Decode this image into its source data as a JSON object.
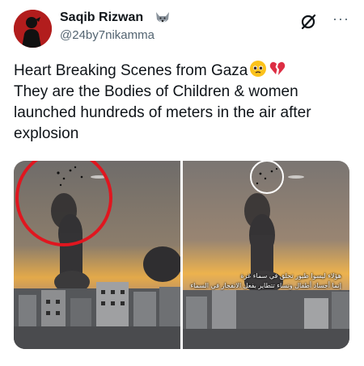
{
  "author": {
    "display_name": "Saqib Rizwan",
    "handle": "@24by7nikamma",
    "badge_icon": "wolf-emoji-icon",
    "avatar_icon": "silhouette-avatar-icon",
    "avatar_color": "#b21d1d"
  },
  "header_actions": {
    "grok_icon": "grok-slash-circle-icon",
    "more_icon": "more-dots-icon",
    "more_label": "···"
  },
  "tweet": {
    "lines": [
      "Heart Breaking Scenes from Gaza",
      "They are the Bodies of Children & women",
      "launched hundreds of meters in the air after",
      "explosion"
    ],
    "emojis": [
      "pleading-face-emoji-icon",
      "broken-heart-emoji-icon"
    ]
  },
  "media": {
    "left_frame": {
      "highlight": "red-circle",
      "highlight_color": "#e0161f"
    },
    "right_frame": {
      "highlight": "white-circle",
      "caption_lines": [
        "هؤلاء ليسوا طيور تحلق في سماء غزة",
        "إنما أجساد أطفال ونساء تتطاير بفعل الانفجار في السماء"
      ]
    }
  },
  "colors": {
    "text_primary": "#0f1419",
    "text_secondary": "#536471",
    "broken_heart": "#dd2e44"
  }
}
